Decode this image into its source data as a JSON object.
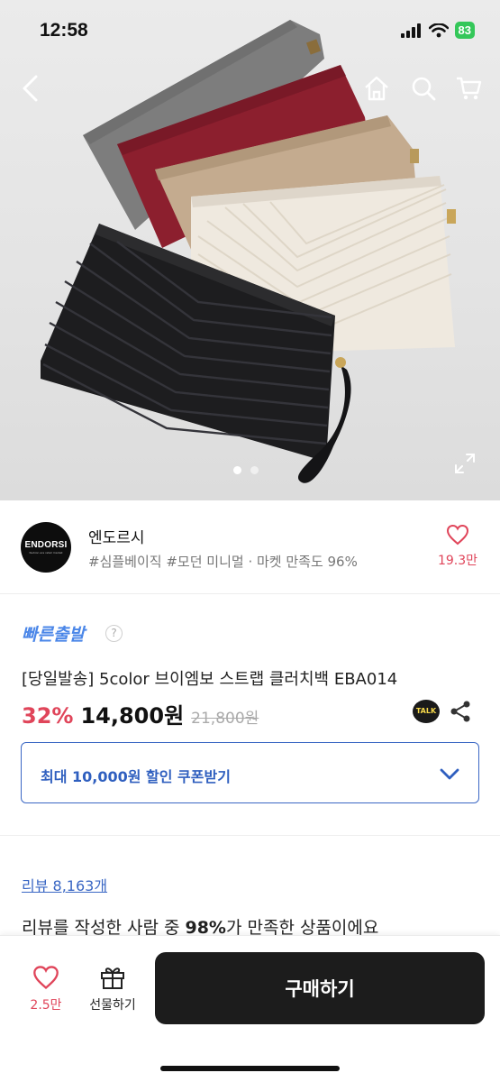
{
  "status_bar": {
    "time": "12:58",
    "battery": "83"
  },
  "seller": {
    "logo_text": "ENDORSI",
    "logo_subtext": "fashion are retail market",
    "name": "엔도르시",
    "tags": "#심플베이직 #모던 미니멀 · 마켓 만족도 96%",
    "like_count": "19.3만"
  },
  "product": {
    "fast_badge": "빠른출발",
    "help_mark": "?",
    "title": "[당일발송] 5color 브이엠보 스트랩 클러치백 EBA014",
    "discount": "32%",
    "price": "14,800원",
    "original_price": "21,800원",
    "talk_label": "TALK"
  },
  "coupon": {
    "label": "최대 10,000원 할인 쿠폰받기"
  },
  "reviews": {
    "link": "리뷰 8,163개",
    "summary_pre": "리뷰를 작성한 사람 중 ",
    "summary_pct": "98%",
    "summary_post": "가 만족한 상품이에요"
  },
  "bottom_bar": {
    "like_count": "2.5만",
    "gift_label": "선물하기",
    "buy_label": "구매하기"
  },
  "image_carousel": {
    "total": 2,
    "current": 1
  },
  "colors": {
    "accent_red": "#e0455a",
    "accent_blue": "#3a67c4",
    "buy_button": "#1c1c1c",
    "clutch_colors": [
      "#7d7d7d",
      "#8c1f2e",
      "#c4ab8f",
      "#efe9df",
      "#1d1d1f"
    ]
  }
}
